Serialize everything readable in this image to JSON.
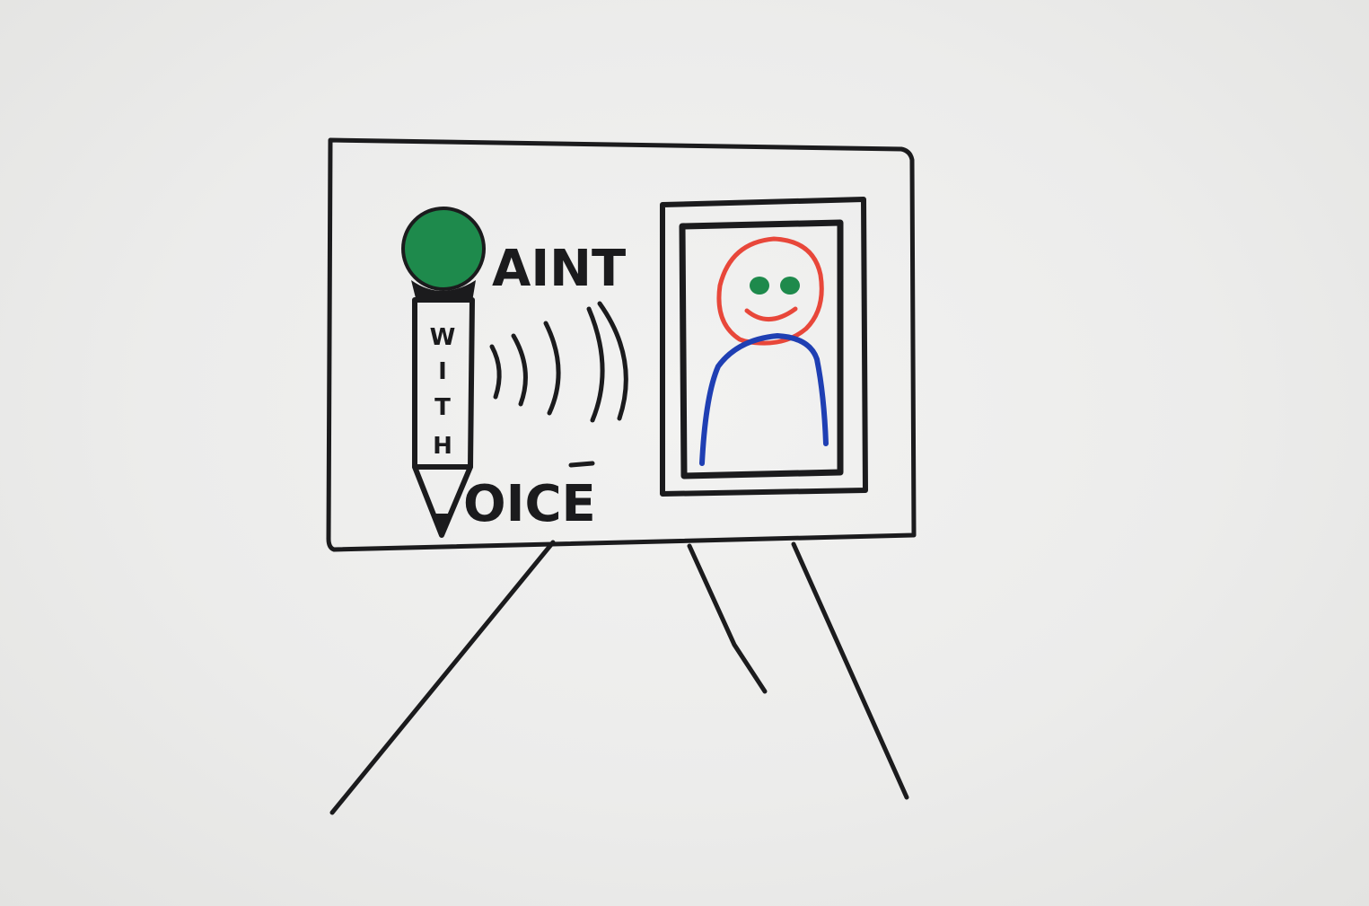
{
  "sketch": {
    "title_word_1": "AINT",
    "title_word_2": "OICE",
    "pencil_letters": [
      "W",
      "I",
      "T",
      "H"
    ],
    "logo_letters_note_colors": {
      "ink": "#1b1b1d",
      "mic_head": "#1e8a4c",
      "face": "#e8473a",
      "eyes": "#1e8a4c",
      "body": "#1f3fb3"
    }
  }
}
